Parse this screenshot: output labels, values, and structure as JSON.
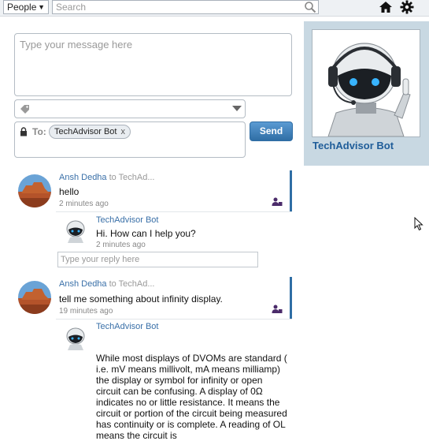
{
  "topbar": {
    "people_label": "People",
    "search_placeholder": "Search"
  },
  "composer": {
    "message_placeholder": "Type your message here",
    "to_label": "To:",
    "recipient_chip": "TechAdvisor Bot",
    "chip_remove": "x",
    "send_label": "Send"
  },
  "profile": {
    "name": "TechAdvisor Bot"
  },
  "feed": {
    "posts": [
      {
        "author": "Ansh Dedha",
        "to_text": " to TechAd...",
        "body": "hello",
        "time": "2 minutes ago",
        "reply": {
          "author": "TechAdvisor Bot",
          "body": "Hi. How can I help you?",
          "time": "2 minutes ago"
        },
        "reply_placeholder": "Type your reply here"
      },
      {
        "author": "Ansh Dedha",
        "to_text": " to TechAd...",
        "body": "tell me something about infinity display.",
        "time": "19 minutes ago",
        "reply": {
          "author": "TechAdvisor Bot",
          "body": "While most displays of DVOMs are standard ( i.e. mV means millivolt, mA means milliamp) the display or symbol for infinity or open circuit can be confusing. A display of 0Ω indicates no or little resistance. It means the circuit or portion of the circuit being measured has continuity or is complete. A reading of OL means the circuit is"
        }
      }
    ]
  },
  "colors": {
    "accent": "#2f6ea5",
    "link": "#3a70a8",
    "panel": "#c8d8e2"
  }
}
